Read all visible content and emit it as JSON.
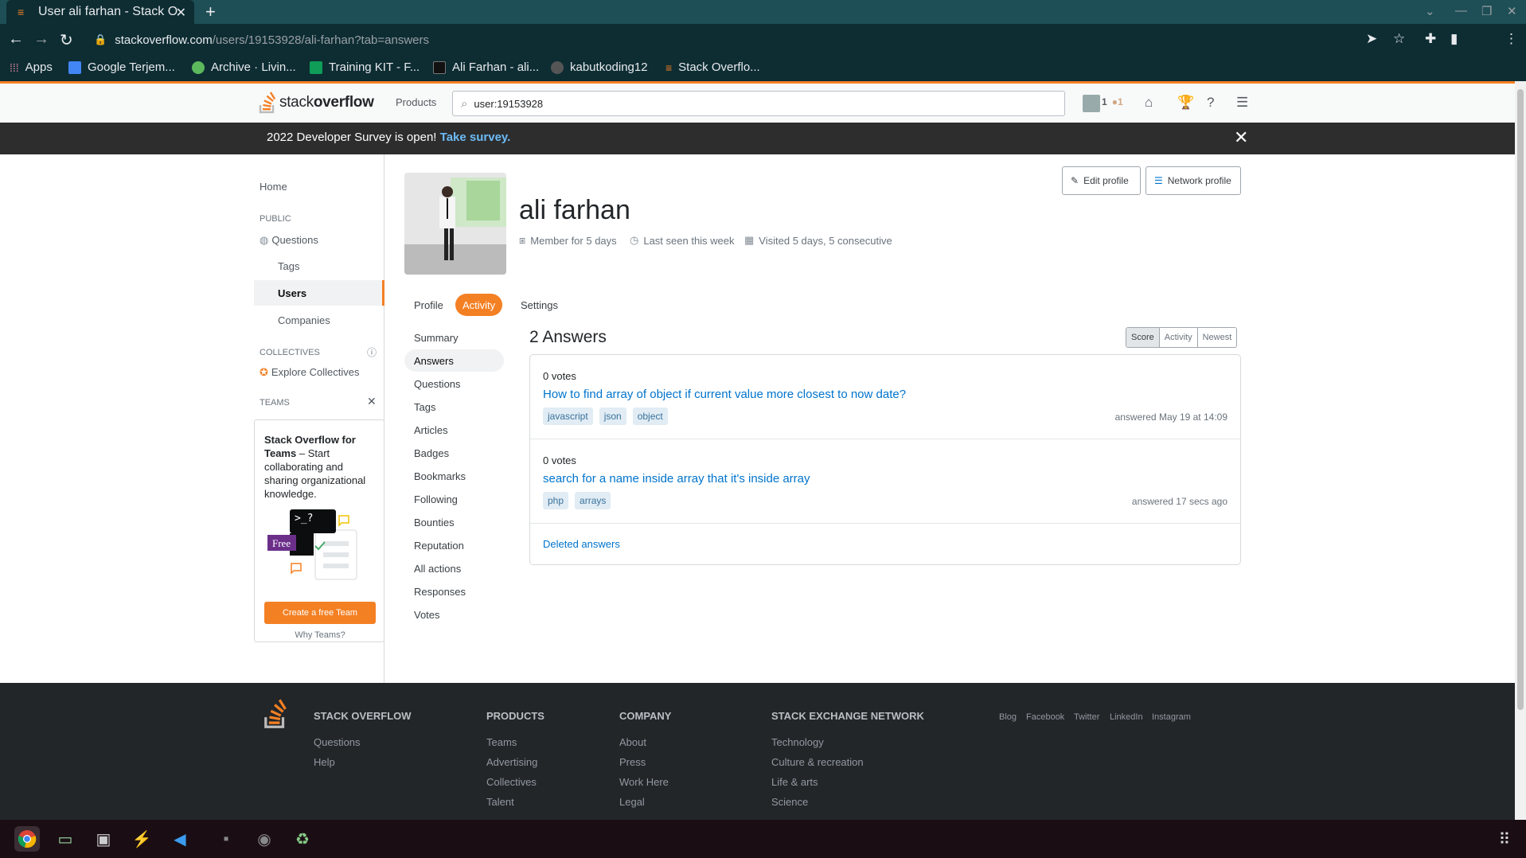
{
  "browser": {
    "tab_title": "User ali farhan - Stack Overflow",
    "url_host": "stackoverflow.com",
    "url_path": "/users/19153928/ali-farhan?tab=answers",
    "bookmarks": [
      "Apps",
      "Google Terjem...",
      "Archive · Livin...",
      "Training KIT - F...",
      "Ali Farhan - ali...",
      "kabutkoding12",
      "Stack Overflo..."
    ]
  },
  "so_header": {
    "logo_light": "stack",
    "logo_bold": "overflow",
    "products": "Products",
    "search_value": "user:19153928",
    "reputation": "1",
    "bronze": "1"
  },
  "banner": {
    "text": "2022 Developer Survey is open!",
    "link": "Take survey."
  },
  "left_nav": {
    "home": "Home",
    "public_head": "PUBLIC",
    "questions": "Questions",
    "tags": "Tags",
    "users": "Users",
    "companies": "Companies",
    "collectives_head": "COLLECTIVES",
    "explore_collectives": "Explore Collectives",
    "teams_head": "TEAMS",
    "teams_title": "Stack Overflow for Teams",
    "teams_desc": "– Start collaborating and sharing organizational knowledge.",
    "teams_badge": "Free",
    "teams_prompt": ">_?",
    "create_team": "Create a free Team",
    "why_teams": "Why Teams?"
  },
  "profile": {
    "name": "ali farhan",
    "member_for": "Member for 5 days",
    "last_seen": "Last seen this week",
    "visited": "Visited 5 days, 5 consecutive",
    "edit_profile": "Edit profile",
    "network_profile": "Network profile",
    "tabs": [
      "Profile",
      "Activity",
      "Settings"
    ]
  },
  "activity_nav": [
    "Summary",
    "Answers",
    "Questions",
    "Tags",
    "Articles",
    "Badges",
    "Bookmarks",
    "Following",
    "Bounties",
    "Reputation",
    "All actions",
    "Responses",
    "Votes"
  ],
  "answers": {
    "title": "2 Answers",
    "sort": [
      "Score",
      "Activity",
      "Newest"
    ],
    "items": [
      {
        "votes": "0 votes",
        "title": "How to find array of object if current value more closest to now date?",
        "tags": [
          "javascript",
          "json",
          "object"
        ],
        "when": "answered May 19 at 14:09"
      },
      {
        "votes": "0 votes",
        "title": "search for a name inside array that it's inside array",
        "tags": [
          "php",
          "arrays"
        ],
        "when": "answered 17 secs ago"
      }
    ],
    "deleted": "Deleted answers"
  },
  "footer": {
    "so": "STACK OVERFLOW",
    "so_links": [
      "Questions",
      "Help"
    ],
    "products": "PRODUCTS",
    "products_links": [
      "Teams",
      "Advertising",
      "Collectives",
      "Talent"
    ],
    "company": "COMPANY",
    "company_links": [
      "About",
      "Press",
      "Work Here",
      "Legal"
    ],
    "network": "STACK EXCHANGE NETWORK",
    "network_links": [
      "Technology",
      "Culture & recreation",
      "Life & arts",
      "Science"
    ],
    "social": [
      "Blog",
      "Facebook",
      "Twitter",
      "LinkedIn",
      "Instagram"
    ]
  },
  "colors": {
    "accent": "#f48024",
    "link": "#0074cc",
    "tag_bg": "#e1ecf4",
    "footer_bg": "#232629"
  }
}
